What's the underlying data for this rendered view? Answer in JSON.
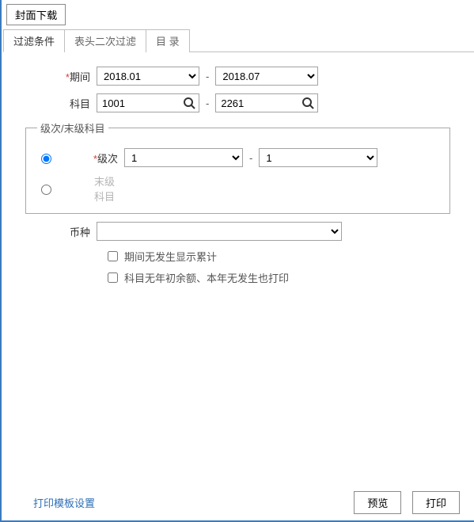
{
  "topButton": "封面下载",
  "tabs": [
    "过滤条件",
    "表头二次过滤",
    "目 录"
  ],
  "activeTab": 0,
  "period": {
    "label": "期间",
    "required": true,
    "from": "2018.01",
    "to": "2018.07"
  },
  "subject": {
    "label": "科目",
    "from": "1001",
    "to": "2261"
  },
  "levelGroup": {
    "legend": "级次/末级科目",
    "levelLabel": "级次",
    "levelRequired": true,
    "levelFrom": "1",
    "levelTo": "1",
    "leafLabel": "末级科目",
    "mode": "level"
  },
  "currency": {
    "label": "币种",
    "value": ""
  },
  "checks": {
    "noActivityLabel": "期间无发生显示累计",
    "noActivity": false,
    "noBalanceLabel": "科目无年初余额、本年无发生也打印",
    "noBalance": false
  },
  "footer": {
    "link": "打印模板设置",
    "previewBtn": "预览",
    "printBtn": "打印"
  }
}
